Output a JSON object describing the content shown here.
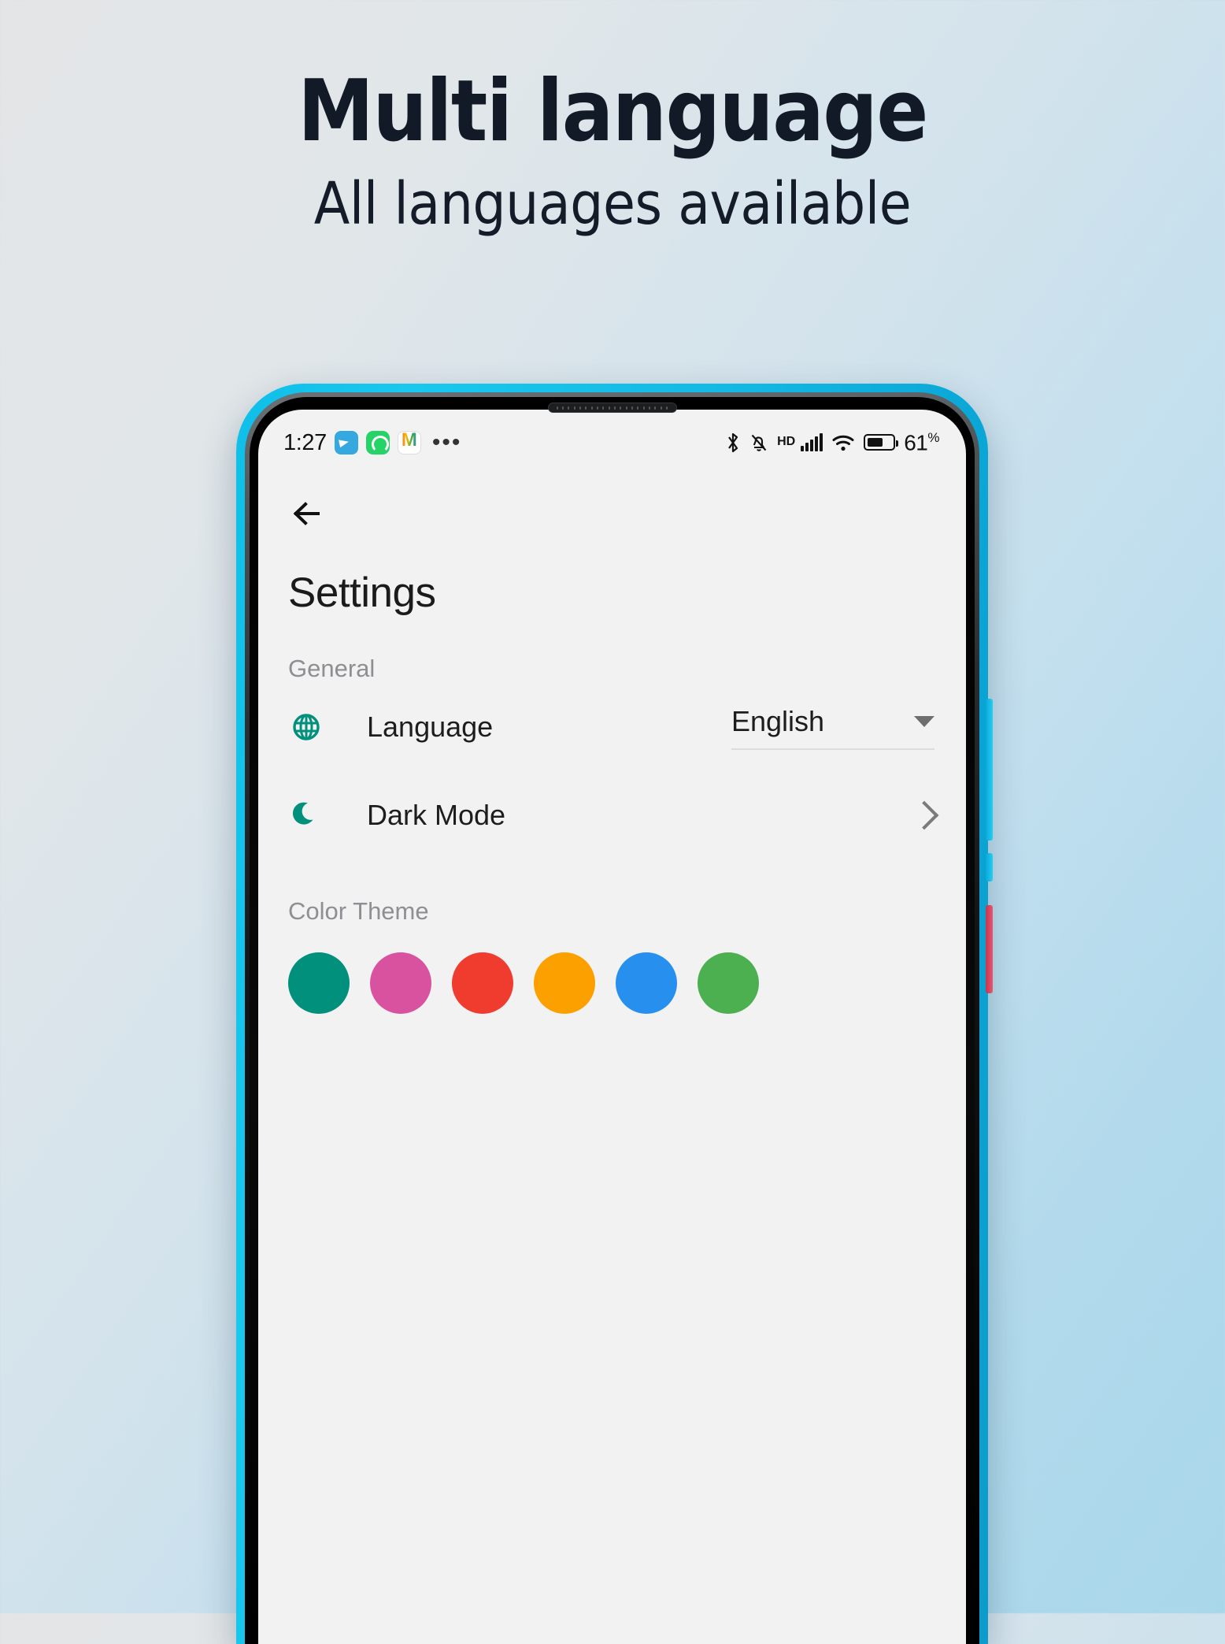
{
  "promo": {
    "title": "Multi language",
    "subtitle": "All languages available",
    "title_color": "#121a28"
  },
  "background": {
    "gradient_from": "#e3e5e6",
    "gradient_to": "#a9d7ea"
  },
  "phone": {
    "frame_color": "#13bce6",
    "bezel_color": "#0a0a0b",
    "volume_button_color": "#18c8ef",
    "power_button_color": "#d8455e"
  },
  "statusbar": {
    "time": "1:27",
    "app_icons": [
      "telegram-icon",
      "whatsapp-icon",
      "gmail-icon"
    ],
    "overflow": "•••",
    "bluetooth": "bluetooth-icon",
    "silent": "bell-muted-icon",
    "hd_label": "HD",
    "signal": "cellular-signal-icon",
    "wifi": "wifi-icon",
    "battery": "battery-icon",
    "battery_level": "61",
    "battery_unit": "%"
  },
  "app": {
    "back": "back-arrow",
    "title": "Settings",
    "general_label": "General",
    "rows": [
      {
        "icon": "globe-icon",
        "label": "Language",
        "control": "dropdown",
        "value": "English"
      },
      {
        "icon": "moon-icon",
        "label": "Dark Mode",
        "control": "chevron"
      }
    ],
    "color_theme_label": "Color Theme",
    "accent_color": "#00907c",
    "swatches": [
      {
        "name": "teal",
        "hex": "#00907c"
      },
      {
        "name": "pink",
        "hex": "#d9529f"
      },
      {
        "name": "red",
        "hex": "#f03c2e"
      },
      {
        "name": "orange",
        "hex": "#fca000"
      },
      {
        "name": "blue",
        "hex": "#2790ef"
      },
      {
        "name": "green",
        "hex": "#4caf50"
      }
    ]
  }
}
